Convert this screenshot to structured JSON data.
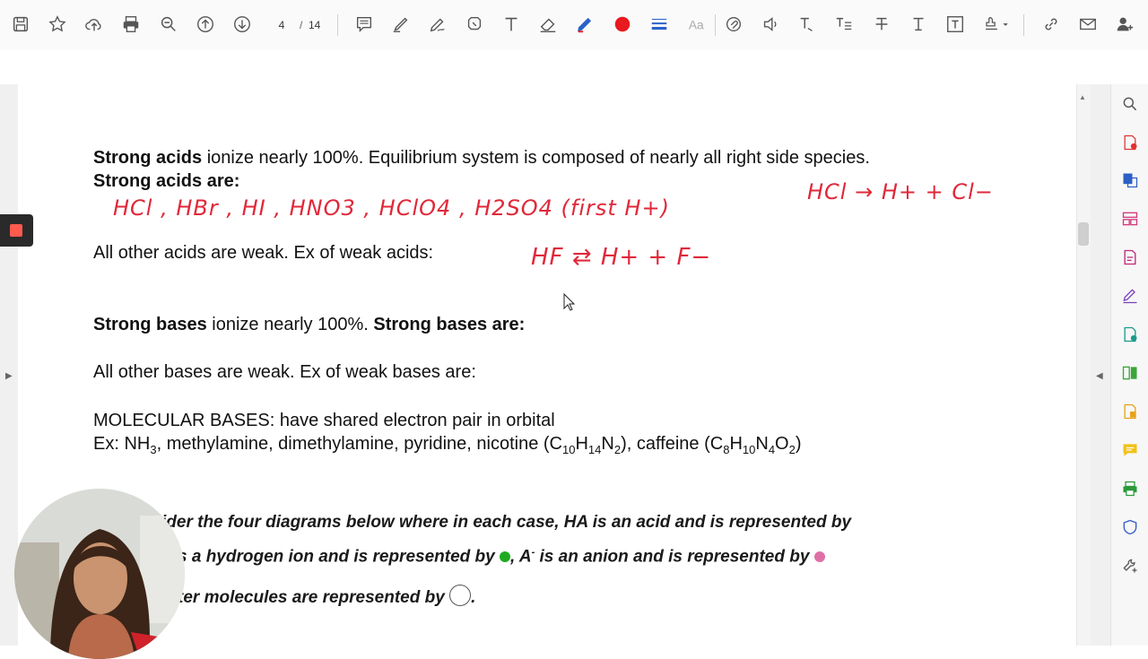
{
  "toolbar": {
    "page_current": "4",
    "page_separator": "/",
    "page_total": "14",
    "icons": [
      "save-icon",
      "bookmark-star-icon",
      "upload-cloud-icon",
      "print-icon",
      "zoom-icon",
      "page-up-icon",
      "page-down-icon",
      "comment-icon",
      "highlight-icon",
      "draw-icon",
      "stamp-icon",
      "text-icon",
      "eraser-icon",
      "pen-icon",
      "color-red-icon",
      "line-weight-icon",
      "font-size-icon",
      "attach-icon",
      "audio-icon",
      "text-strike-icon",
      "replace-text-icon",
      "strikethrough-icon",
      "text-box-icon",
      "text-frame-icon",
      "stamp-menu-icon",
      "link-icon",
      "email-icon",
      "add-user-icon"
    ],
    "accent_red": "#e8191f",
    "accent_blue": "#2a62c9"
  },
  "document": {
    "line1_bold": "Strong acids",
    "line1_rest": " ionize nearly 100%.  Equilibrium system is composed of nearly all right side species.",
    "line2_bold": "Strong acids are:",
    "hand_acids_list": "HCl , HBr , HI , HNO3 , HClO4 , H2SO4 (first H+)",
    "hand_hcl_eq": "HCl → H+ + Cl−",
    "weak_acids_line": "All other acids are weak.  Ex of weak acids:",
    "hand_hf_eq": "HF ⇄ H+ + F−",
    "bases_bold1": "Strong bases",
    "bases_rest": " ionize nearly 100%.  ",
    "bases_bold2": "Strong bases are:",
    "weak_bases_line": "All other bases are weak.  Ex of weak bases are:",
    "molecular_line": "MOLECULAR BASES:  have shared electron pair in orbital",
    "ex_line_prefix": "Ex:  NH",
    "ex_sub_nh3": "3",
    "ex_line_mid": ", methylamine, dimethylamine, pyridine, nicotine (C",
    "nic_10": "10",
    "nic_h": "H",
    "nic_14": "14",
    "nic_n": "N",
    "nic_2": "2",
    "ex_line_mid2": "), caffeine (C",
    "caf_8": "8",
    "caf_h": "H",
    "caf_10": "10",
    "caf_n": "N",
    "caf_4": "4",
    "caf_o": "O",
    "caf_2": "2",
    "ex_line_end": ")",
    "q_line1": "ider the four diagrams below where in each case, HA is an acid and is represented by",
    "q_line2a": "s a hydrogen ion and is represented by ",
    "q_line2b": ", A",
    "q_line2_sup": "-",
    "q_line2c": " is an anion and is represented by ",
    "q_line3a": "ter molecules are represented by ",
    "q_line3b": "."
  },
  "colors": {
    "handwriting": "#e0283a",
    "green_dot": "#1faa1f",
    "pink_dot": "#e06fa8"
  },
  "right_panel": {
    "icons": [
      "search-icon",
      "create-pdf-icon",
      "export-pdf-icon",
      "organize-pages-icon",
      "edit-pdf-icon",
      "fill-sign-icon",
      "send-review-icon",
      "compare-icon",
      "scan-icon",
      "comment-tool-icon",
      "print-production-icon",
      "protect-icon",
      "more-tools-icon"
    ]
  }
}
